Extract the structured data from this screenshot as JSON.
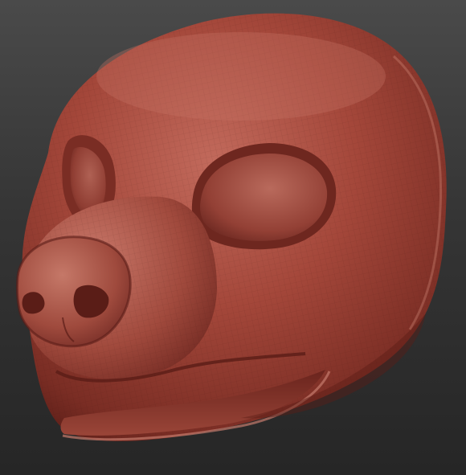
{
  "scene": {
    "background_top": "#4a4a4a",
    "background_bottom": "#262626",
    "model_base_color": "#9c3f34",
    "model_highlight_color": "#c76a5a",
    "model_shadow_color": "#5e1f18",
    "subject": "sculpted-animal-head-mask"
  }
}
